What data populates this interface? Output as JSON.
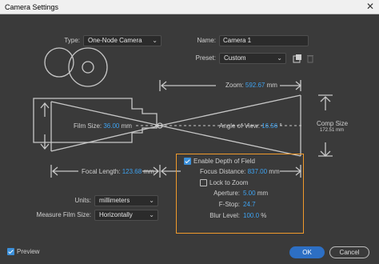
{
  "window": {
    "title": "Camera Settings",
    "close_glyph": "✕"
  },
  "type": {
    "label": "Type:",
    "value": "One-Node Camera"
  },
  "name": {
    "label": "Name:",
    "value": "Camera 1"
  },
  "preset": {
    "label": "Preset:",
    "value": "Custom",
    "save_icon": "save-preset-icon",
    "delete_icon": "trash-icon"
  },
  "diagram": {
    "zoom_label": "Zoom:",
    "zoom_value": "592.67",
    "zoom_unit": "mm",
    "film_size_label": "Film Size:",
    "film_size_value": "36.00",
    "film_size_unit": "mm",
    "angle_of_view_label": "Angle of View:",
    "angle_of_view_value": "16.56",
    "angle_of_view_unit": "°",
    "comp_size_label": "Comp Size",
    "comp_size_value": "172.51 mm",
    "focal_length_label": "Focal Length:",
    "focal_length_value": "123.68",
    "focal_length_unit": "mm"
  },
  "dof": {
    "enable_label": "Enable Depth of Field",
    "enable_checked": true,
    "focus_distance_label": "Focus Distance:",
    "focus_distance_value": "837.00",
    "focus_distance_unit": "mm",
    "lock_to_zoom_label": "Lock to Zoom",
    "lock_to_zoom_checked": false,
    "aperture_label": "Aperture:",
    "aperture_value": "5.00",
    "aperture_unit": "mm",
    "fstop_label": "F-Stop:",
    "fstop_value": "24.7",
    "blur_level_label": "Blur Level:",
    "blur_level_value": "100.0",
    "blur_level_unit": "%"
  },
  "units": {
    "label": "Units:",
    "value": "millimeters"
  },
  "measure_film_size": {
    "label": "Measure Film Size:",
    "value": "Horizontally"
  },
  "footer": {
    "preview_label": "Preview",
    "preview_checked": true,
    "ok_label": "OK",
    "cancel_label": "Cancel"
  },
  "colors": {
    "accent": "#3ea2f0",
    "highlight_box": "#f09a2b",
    "background": "#3a3a3a",
    "line": "#c8c8c8"
  }
}
